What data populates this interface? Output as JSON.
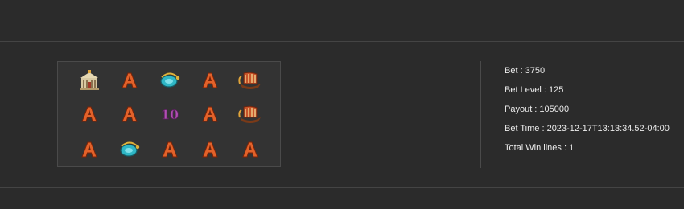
{
  "reels": {
    "rows": [
      [
        "temple-icon",
        "letter-a-icon",
        "amulet-icon",
        "letter-a-icon",
        "ship-icon"
      ],
      [
        "letter-a-icon",
        "letter-a-icon",
        "ten-icon",
        "letter-a-icon",
        "ship-icon"
      ],
      [
        "letter-a-icon",
        "amulet-icon",
        "letter-a-icon",
        "letter-a-icon",
        "letter-a-icon"
      ]
    ],
    "ten_text": "10",
    "colors": {
      "a_fill": "#e2622a",
      "a_stroke": "#7a2308",
      "ten": "#b04fb3",
      "ship": "#c9542a",
      "amulet": "#2fb7c6",
      "temple": "#d8c9a2"
    }
  },
  "details": {
    "bet": "Bet : 3750",
    "bet_level": "Bet Level : 125",
    "payout": "Payout : 105000",
    "bet_time": "Bet Time : 2023-12-17T13:13:34.52-04:00",
    "total_win_lines": "Total Win lines : 1"
  }
}
